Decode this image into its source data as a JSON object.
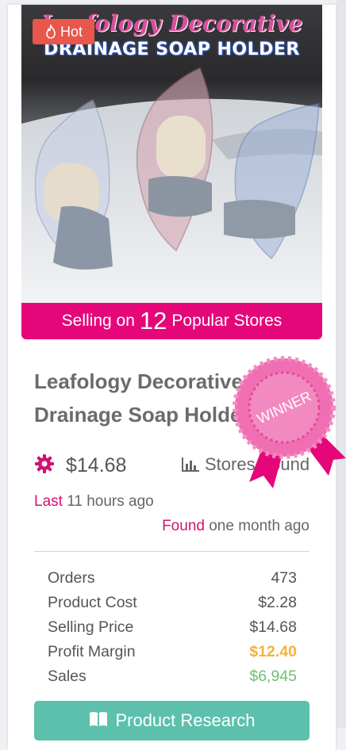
{
  "image": {
    "title": "Leafology Decorative",
    "subtitle": "DRAINAGE SOAP HOLDER"
  },
  "badge": {
    "label": "Hot",
    "icon": "flame-icon"
  },
  "banner": {
    "prefix": "Selling on",
    "count": "12",
    "suffix": "Popular Stores"
  },
  "product": {
    "title_line1": "Leafology Decorative",
    "title_line2": "Drainage Soap Holder",
    "price": "$14.68",
    "stores_label": "Stores Found",
    "last_label": "Last",
    "last_value": "11 hours ago",
    "found_label": "Found",
    "found_value": "one month ago",
    "winner_label": "WINNER"
  },
  "stats": [
    {
      "label": "Orders",
      "value": "473"
    },
    {
      "label": "Product Cost",
      "value": "$2.28"
    },
    {
      "label": "Selling Price",
      "value": "$14.68"
    },
    {
      "label": "Profit Margin",
      "value": "$12.40"
    },
    {
      "label": "Sales",
      "value": "$6,945"
    }
  ],
  "button": {
    "label": "Product Research"
  },
  "colors": {
    "accent": "#e5077a",
    "profit": "#f4b23c",
    "sales": "#6cc070",
    "button": "#5cc0ad",
    "hot": "#e8564c"
  }
}
